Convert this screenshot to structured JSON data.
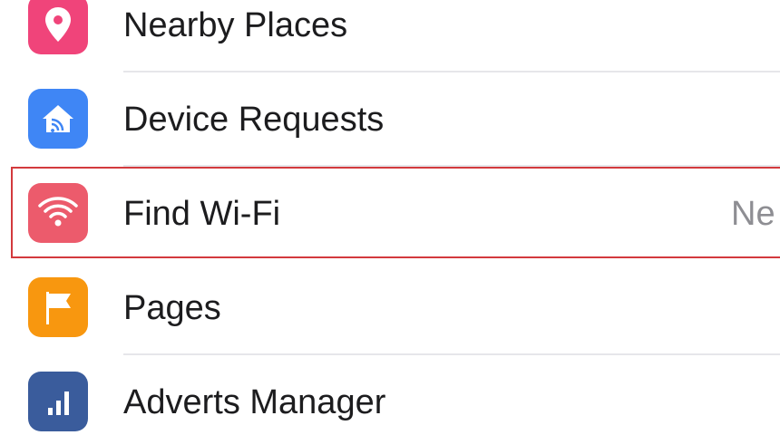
{
  "menu": {
    "items": [
      {
        "label": "Nearby Places",
        "icon": "location-pin-icon",
        "color": "#f0447a"
      },
      {
        "label": "Device Requests",
        "icon": "home-wifi-icon",
        "color": "#3f86f5"
      },
      {
        "label": "Find Wi-Fi",
        "icon": "wifi-icon",
        "color": "#ec5b6c",
        "badge": "Ne",
        "highlighted": true
      },
      {
        "label": "Pages",
        "icon": "flag-icon",
        "color": "#f8970f"
      },
      {
        "label": "Adverts Manager",
        "icon": "bar-chart-icon",
        "color": "#3a5c9c"
      }
    ]
  },
  "highlight_color": "#d33a3d"
}
